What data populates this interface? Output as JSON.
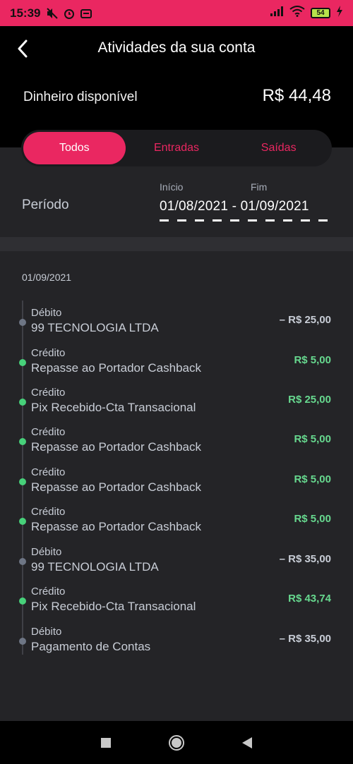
{
  "status_bar": {
    "time": "15:39",
    "battery": "54",
    "icons": [
      "mute-icon",
      "alarm-icon",
      "notification-icon",
      "signal-icon",
      "wifi-icon",
      "battery-icon",
      "charging-icon"
    ]
  },
  "header": {
    "title": "Atividades da sua conta",
    "balance_label": "Dinheiro disponível",
    "balance_value": "R$ 44,48"
  },
  "tabs": [
    {
      "label": "Todos",
      "active": true
    },
    {
      "label": "Entradas",
      "active": false
    },
    {
      "label": "Saídas",
      "active": false
    }
  ],
  "period": {
    "label": "Período",
    "start_label": "Início",
    "end_label": "Fim",
    "range": "01/08/2021 - 01/09/2021"
  },
  "day": "01/09/2021",
  "transactions": [
    {
      "type": "Débito",
      "description": "99 TECNOLOGIA LTDA",
      "amount": "– R$ 25,00",
      "kind": "debit"
    },
    {
      "type": "Crédito",
      "description": "Repasse ao Portador Cashback",
      "amount": "R$ 5,00",
      "kind": "credit"
    },
    {
      "type": "Crédito",
      "description": "Pix Recebido-Cta Transacional",
      "amount": "R$ 25,00",
      "kind": "credit"
    },
    {
      "type": "Crédito",
      "description": "Repasse ao Portador Cashback",
      "amount": "R$ 5,00",
      "kind": "credit"
    },
    {
      "type": "Crédito",
      "description": "Repasse ao Portador Cashback",
      "amount": "R$ 5,00",
      "kind": "credit"
    },
    {
      "type": "Crédito",
      "description": "Repasse ao Portador Cashback",
      "amount": "R$ 5,00",
      "kind": "credit"
    },
    {
      "type": "Débito",
      "description": "99 TECNOLOGIA LTDA",
      "amount": "– R$ 35,00",
      "kind": "debit"
    },
    {
      "type": "Crédito",
      "description": "Pix Recebido-Cta Transacional",
      "amount": "R$ 43,74",
      "kind": "credit"
    },
    {
      "type": "Débito",
      "description": "Pagamento de Contas",
      "amount": "– R$ 35,00",
      "kind": "debit"
    }
  ],
  "colors": {
    "accent": "#ea2761",
    "credit": "#67d98f",
    "debit": "#c8cdd6",
    "surface": "#242427"
  },
  "navbar": {
    "icons": [
      "recent-apps-icon",
      "home-icon",
      "back-icon"
    ]
  }
}
